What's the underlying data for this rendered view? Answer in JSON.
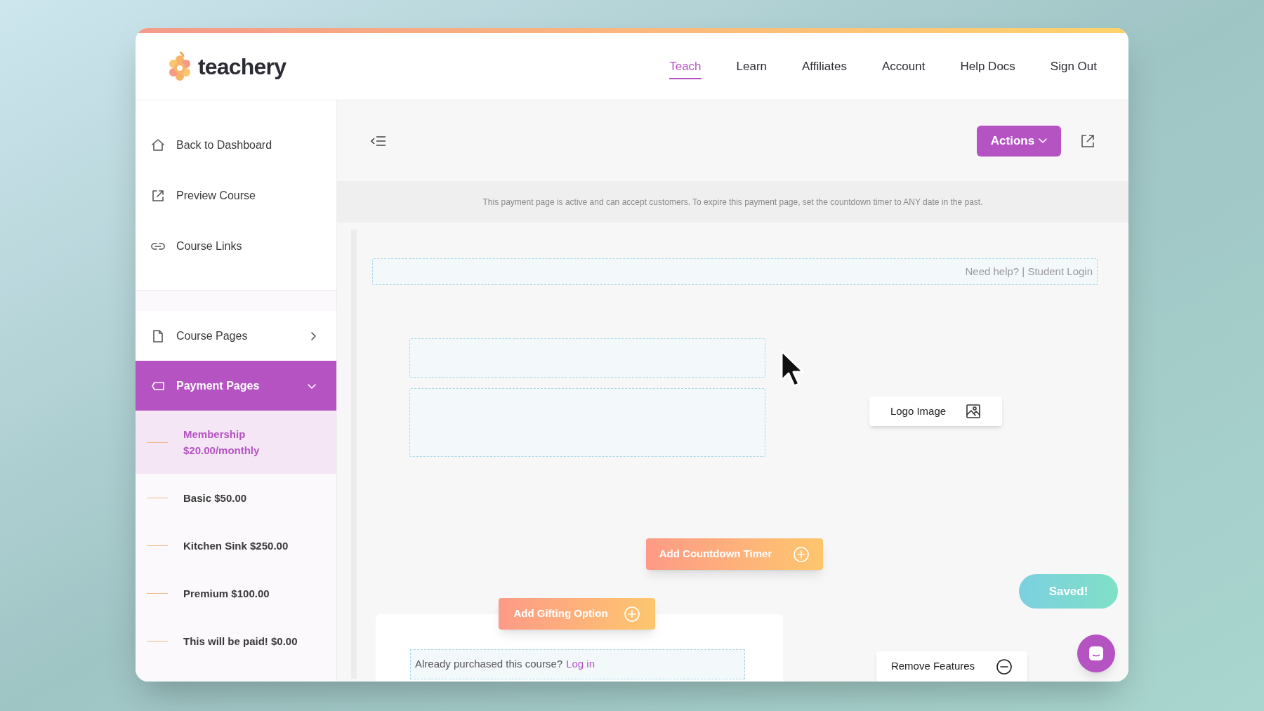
{
  "logo": {
    "text": "teachery"
  },
  "nav": [
    {
      "label": "Teach",
      "selected": true
    },
    {
      "label": "Learn",
      "selected": false
    },
    {
      "label": "Affiliates",
      "selected": false
    },
    {
      "label": "Account",
      "selected": false
    },
    {
      "label": "Help Docs",
      "selected": false
    },
    {
      "label": "Sign Out",
      "selected": false
    }
  ],
  "sidebar": {
    "top_items": [
      {
        "label": "Back to Dashboard",
        "kind": "home"
      },
      {
        "label": "Preview Course",
        "kind": "external"
      },
      {
        "label": "Course Links",
        "kind": "link"
      }
    ],
    "sections": [
      {
        "label": "Course Pages",
        "kind": "page",
        "selected": false,
        "expanded": false
      },
      {
        "label": "Payment Pages",
        "kind": "tag",
        "selected": true,
        "expanded": true,
        "children": [
          {
            "label": "Membership $20.00/monthly",
            "selected": true
          },
          {
            "label": "Basic $50.00",
            "selected": false
          },
          {
            "label": "Kitchen Sink $250.00",
            "selected": false
          },
          {
            "label": "Premium $100.00",
            "selected": false
          },
          {
            "label": "This will be paid! $0.00",
            "selected": false
          }
        ]
      }
    ]
  },
  "toolbar": {
    "actions_button": "Actions"
  },
  "banner": "This payment page is active and can accept customers. To expire this payment page, set the countdown timer to ANY date in the past.",
  "canvas": {
    "help_bar": "Need help? | Student Login",
    "logo_chip": "Logo Image",
    "countdown_button": "Add Countdown Timer",
    "gifting_button": "Add Gifting Option",
    "saved_button": "Saved!",
    "login_prompt": {
      "text": "Already purchased this course?",
      "link": "Log in"
    },
    "remove_chip": "Remove Features"
  }
}
